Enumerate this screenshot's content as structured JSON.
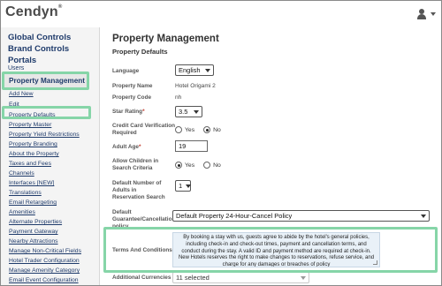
{
  "header": {
    "logo_text": "Cendyn",
    "logo_mark": "®",
    "user_icon": "user-icon"
  },
  "sidebar": {
    "main_items": [
      "Global Controls",
      "Brand Controls",
      "Portals",
      "Users"
    ],
    "active_item": "Property Management",
    "sub_items": [
      "Add New",
      "Edit",
      "Property Defaults",
      "Property Master",
      "Property Yield Restrictions",
      "Property Branding",
      "About the Property",
      "Taxes and Fees",
      "Channels",
      "Interfaces [NEW]",
      "Translations",
      "Email Retargeting",
      "Amenities",
      "Alternate Properties",
      "Payment Gateway",
      "Nearby Attractions",
      "Manage Non-Critical Fields",
      "Hotel Trader Configuration",
      "Manage Amenity Category",
      "Email Event Configuration"
    ]
  },
  "main": {
    "title": "Property Management",
    "subtitle": "Property Defaults",
    "language": {
      "label": "Language",
      "value": "English"
    },
    "property_name": {
      "label": "Property Name",
      "value": "Hotel Origami 2"
    },
    "property_code": {
      "label": "Property Code",
      "value": "nh"
    },
    "star_rating": {
      "label": "Star Rating",
      "value": "3.5"
    },
    "credit_card": {
      "label_1": "Credit Card Verification",
      "label_2": "Required",
      "yes": "Yes",
      "no": "No",
      "selected": "No"
    },
    "adult_age": {
      "label": "Adult Age",
      "value": "19"
    },
    "children": {
      "label_1": "Allow Children in",
      "label_2": "Search Criteria",
      "yes": "Yes",
      "no": "No",
      "selected": "Yes"
    },
    "default_adults": {
      "label_1": "Default Number of",
      "label_2": "Adults in",
      "label_3": "Reservation Search",
      "value": "1"
    },
    "cancellation": {
      "label_1": "Default",
      "label_2": "Guarantee/Cancellation",
      "label_3": "policy",
      "value": "Default Property 24-Hour-Cancel Policy"
    },
    "terms": {
      "label": "Terms And Conditions",
      "text": "By booking a stay with us, guests agree to abide by the hotel's general policies, including check-in and check-out times, payment and cancellation terms, and conduct during the stay. A valid ID and payment method are required at check-in. New Hotels reserves the right to make changes to reservations, refuse service, and charge for any damages or breaches of policy"
    },
    "currencies": {
      "label": "Additional Currencies",
      "value": "11 selected"
    },
    "required_mark": "*"
  },
  "colors": {
    "highlight": "#86d5a8",
    "nav_text": "#1f3b6b",
    "terms_bg": "#e9f1f8"
  }
}
